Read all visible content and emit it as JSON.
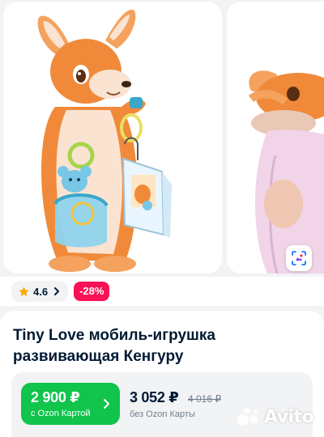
{
  "gallery": {
    "images": [
      {
        "icon": "kangaroo-toy-photo"
      },
      {
        "icon": "baby-with-kangaroo-photo"
      }
    ],
    "scan_icon": "image-search-icon"
  },
  "rating": {
    "value": "4.6",
    "star_icon": "star-icon",
    "star_color": "#ffa800"
  },
  "discount": {
    "label": "-28%",
    "color": "#f91155"
  },
  "product": {
    "title": "Tiny Love мобиль-игрушка развивающая Кенгуру"
  },
  "price": {
    "ozon_card_price": "2 900 ₽",
    "ozon_card_label": "с Ozon Картой",
    "ozon_button_color": "#10c44c",
    "regular_price": "3 052 ₽",
    "old_price": "4 016 ₽",
    "regular_label": "без Ozon Карты"
  },
  "watermark": {
    "text": "Avito"
  }
}
